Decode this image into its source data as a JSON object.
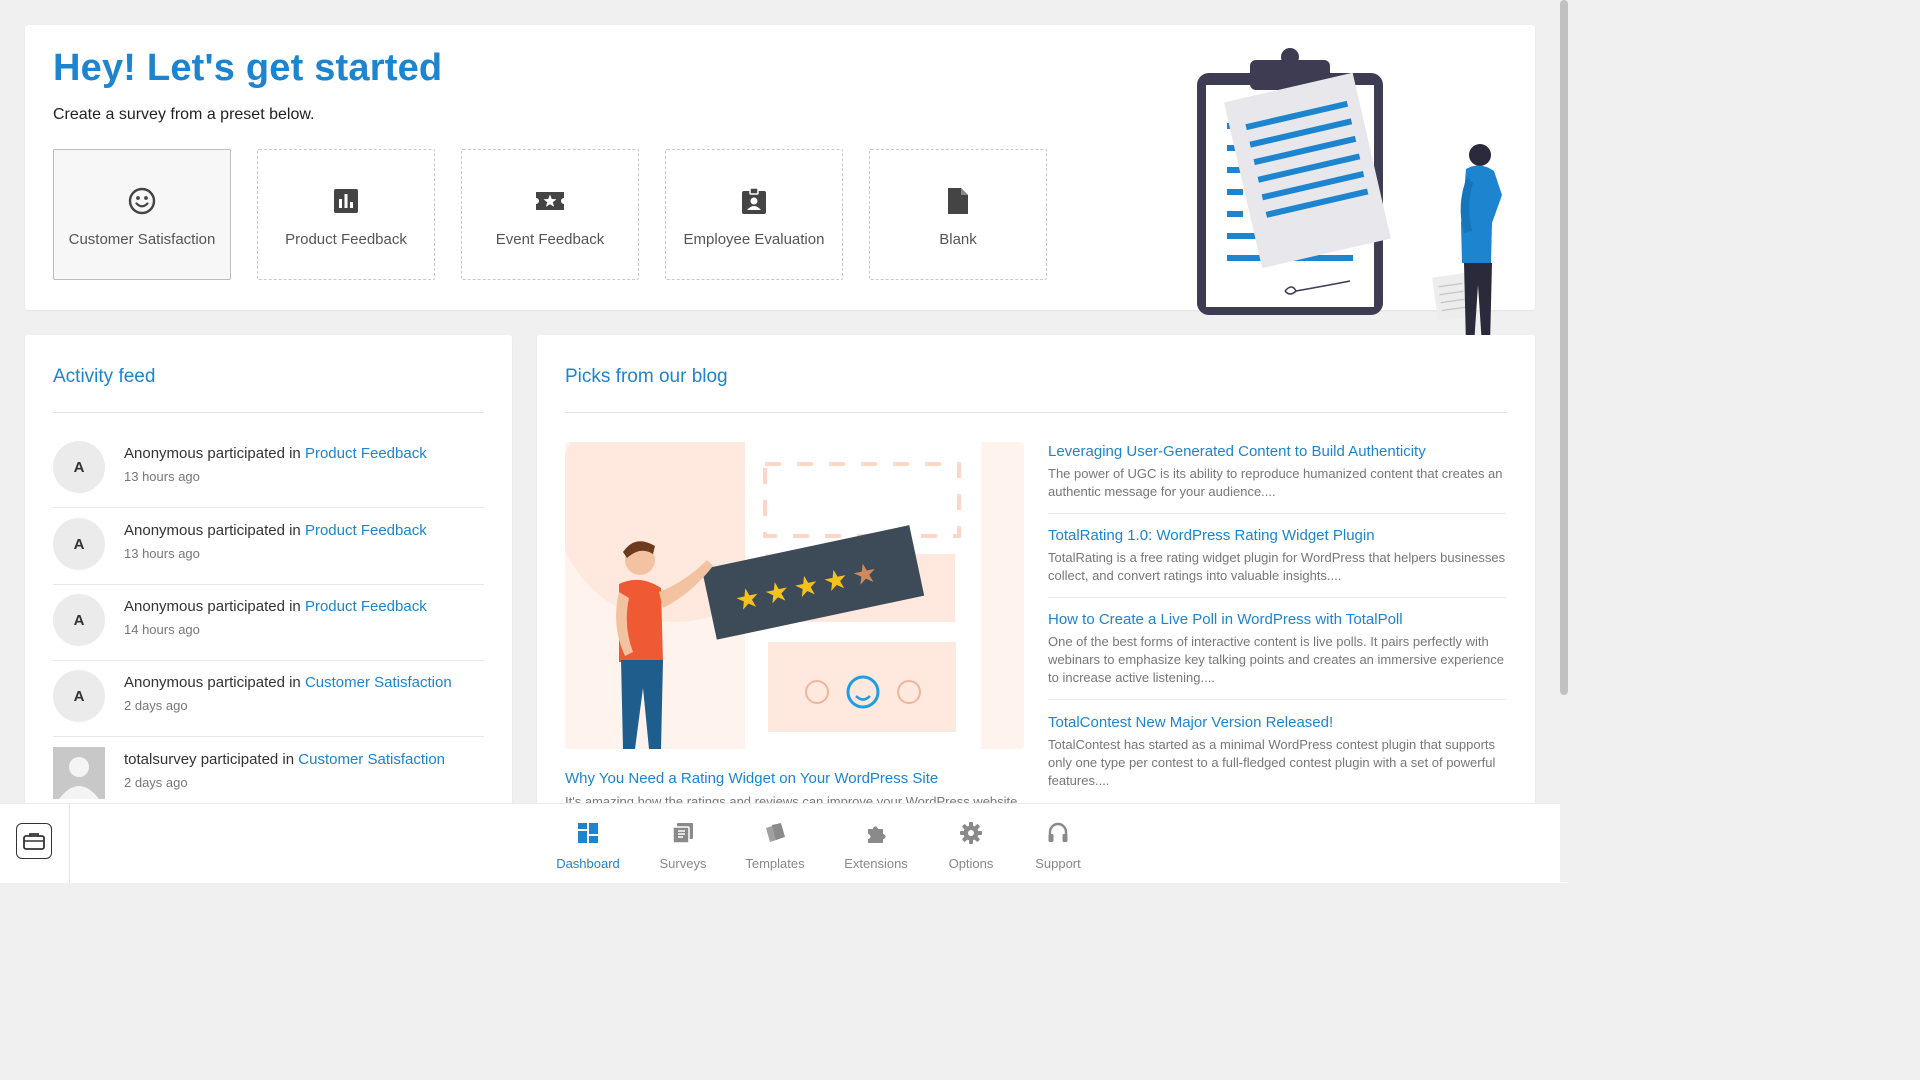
{
  "hero": {
    "title": "Hey! Let's get started",
    "subtitle": "Create a survey from a preset below.",
    "presets": [
      {
        "label": "Customer Satisfaction",
        "icon": "smiley-icon"
      },
      {
        "label": "Product Feedback",
        "icon": "bar-chart-icon"
      },
      {
        "label": "Event Feedback",
        "icon": "ticket-star-icon"
      },
      {
        "label": "Employee Evaluation",
        "icon": "badge-icon"
      },
      {
        "label": "Blank",
        "icon": "file-icon"
      }
    ]
  },
  "activity": {
    "title": "Activity feed",
    "items": [
      {
        "avatar": "A",
        "user": "Anonymous",
        "action": " participated in ",
        "survey": "Product Feedback",
        "time": "13 hours ago"
      },
      {
        "avatar": "A",
        "user": "Anonymous",
        "action": " participated in ",
        "survey": "Product Feedback",
        "time": "13 hours ago"
      },
      {
        "avatar": "A",
        "user": "Anonymous",
        "action": " participated in ",
        "survey": "Product Feedback",
        "time": "14 hours ago"
      },
      {
        "avatar": "A",
        "user": "Anonymous",
        "action": " participated in ",
        "survey": "Customer Satisfaction",
        "time": "2 days ago"
      },
      {
        "avatar": "",
        "user": "totalsurvey",
        "action": " participated in ",
        "survey": "Customer Satisfaction",
        "time": "2 days ago"
      }
    ]
  },
  "blog": {
    "title": "Picks from our blog",
    "featured": {
      "title": "Why You Need a Rating Widget on Your WordPress Site",
      "excerpt": "It's amazing how the ratings and reviews can improve your WordPress website"
    },
    "posts": [
      {
        "title": "Leveraging User-Generated Content to Build Authenticity",
        "excerpt": "The power of UGC is its ability to reproduce humanized content that creates an authentic message for your audience...."
      },
      {
        "title": "TotalRating 1.0: WordPress Rating Widget Plugin",
        "excerpt": "TotalRating is a free rating widget plugin for WordPress that helpers businesses collect, and convert ratings into valuable insights...."
      },
      {
        "title": "How to Create a Live Poll in WordPress with TotalPoll",
        "excerpt": "One of the best forms of interactive content is live polls. It pairs perfectly with webinars to emphasize key talking points and creates an immersive experience to increase active listening...."
      },
      {
        "title": "TotalContest New Major Version Released!",
        "excerpt": "TotalContest has started as a minimal WordPress contest plugin that supports only one type per contest to a full-fledged contest plugin with a set of powerful features...."
      }
    ]
  },
  "nav": {
    "items": [
      {
        "label": "Dashboard",
        "icon": "dashboard-icon",
        "active": true
      },
      {
        "label": "Surveys",
        "icon": "surveys-icon",
        "active": false
      },
      {
        "label": "Templates",
        "icon": "templates-icon",
        "active": false
      },
      {
        "label": "Extensions",
        "icon": "puzzle-icon",
        "active": false
      },
      {
        "label": "Options",
        "icon": "gear-icon",
        "active": false
      },
      {
        "label": "Support",
        "icon": "headset-icon",
        "active": false
      }
    ]
  },
  "colors": {
    "accent": "#1d84d0",
    "background": "#f0f0f0",
    "card": "#ffffff",
    "muted": "#777777"
  }
}
